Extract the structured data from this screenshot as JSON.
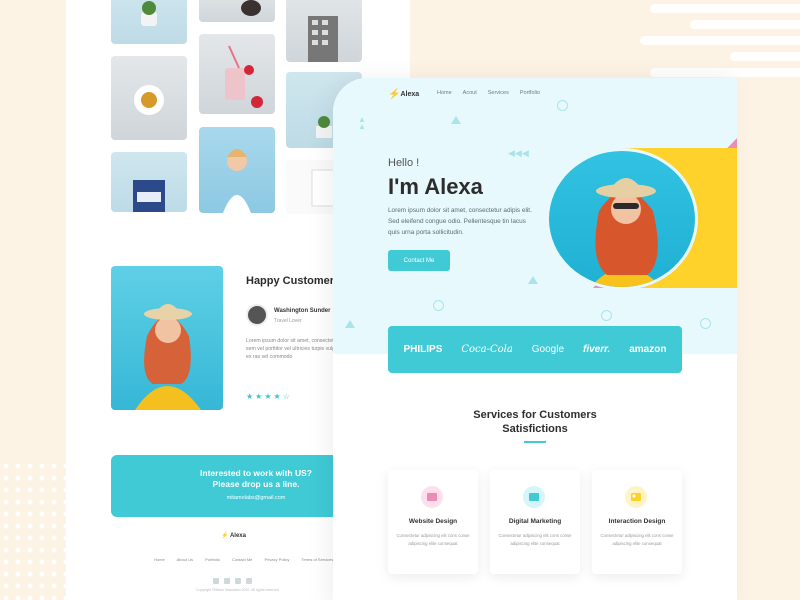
{
  "colors": {
    "accent": "#3fcad6",
    "pink": "#ec8db5",
    "yellow": "#ffd22b",
    "background": "#fdf3e4"
  },
  "back_page": {
    "happy_customer": {
      "title": "Happy Customer",
      "name": "Washington Sunder",
      "role": "Travel Lover",
      "text": "Lorem ipsum dolor sit amet, consectetur adipiscing elit Nulla elementum sem vel porttitor vel ultricies turpis vulputate pellentesque. Donec vehicula ex ras vel commodo",
      "stars": "★★★★☆"
    },
    "cta": {
      "line1": "Interested to work with US?",
      "line2": "Please drop us a line.",
      "email": "mitamolabs@gmail.com"
    },
    "footer": {
      "logo": "Alexa",
      "nav": [
        "Home",
        "About Us",
        "Portfolio",
        "Contact Me",
        "Privacy Policy",
        "Terms of Services"
      ],
      "copyright": "Copyright ©Mitam Mamadou 2020. All rights reserved"
    }
  },
  "front_page": {
    "logo": "Alexa",
    "nav": [
      "Home",
      "Acout",
      "Services",
      "Portfolio"
    ],
    "hello": "Hello !",
    "name": "I'm Alexa",
    "intro": "Lorem ipsum dolor sit amet, consectetur adipis elit. Sed eleifend congue odio. Pellentesque tin lacus quis urna porta sollicitudin.",
    "contact_button": "Contact Me",
    "brands": [
      "PHILIPS",
      "Coca-Cola",
      "Google",
      "fiverr.",
      "amazon"
    ],
    "services_title_line1": "Services for Customers",
    "services_title_line2": "Satisfictions",
    "services": [
      {
        "title": "Website Design",
        "desc": "Consectetur adipiscing elit cons conse adipiscing elite consequat",
        "icon": "browser-icon",
        "color": "#ec8db5"
      },
      {
        "title": "Digital Marketing",
        "desc": "Consectetur adipiscing elit cons conse adipiscing elite consequat",
        "icon": "image-icon",
        "color": "#3fcad6"
      },
      {
        "title": "Interaction Design",
        "desc": "Consectetur adipiscing elit cons conse adipiscing elite consequat",
        "icon": "picture-icon",
        "color": "#ffd22b"
      }
    ]
  }
}
